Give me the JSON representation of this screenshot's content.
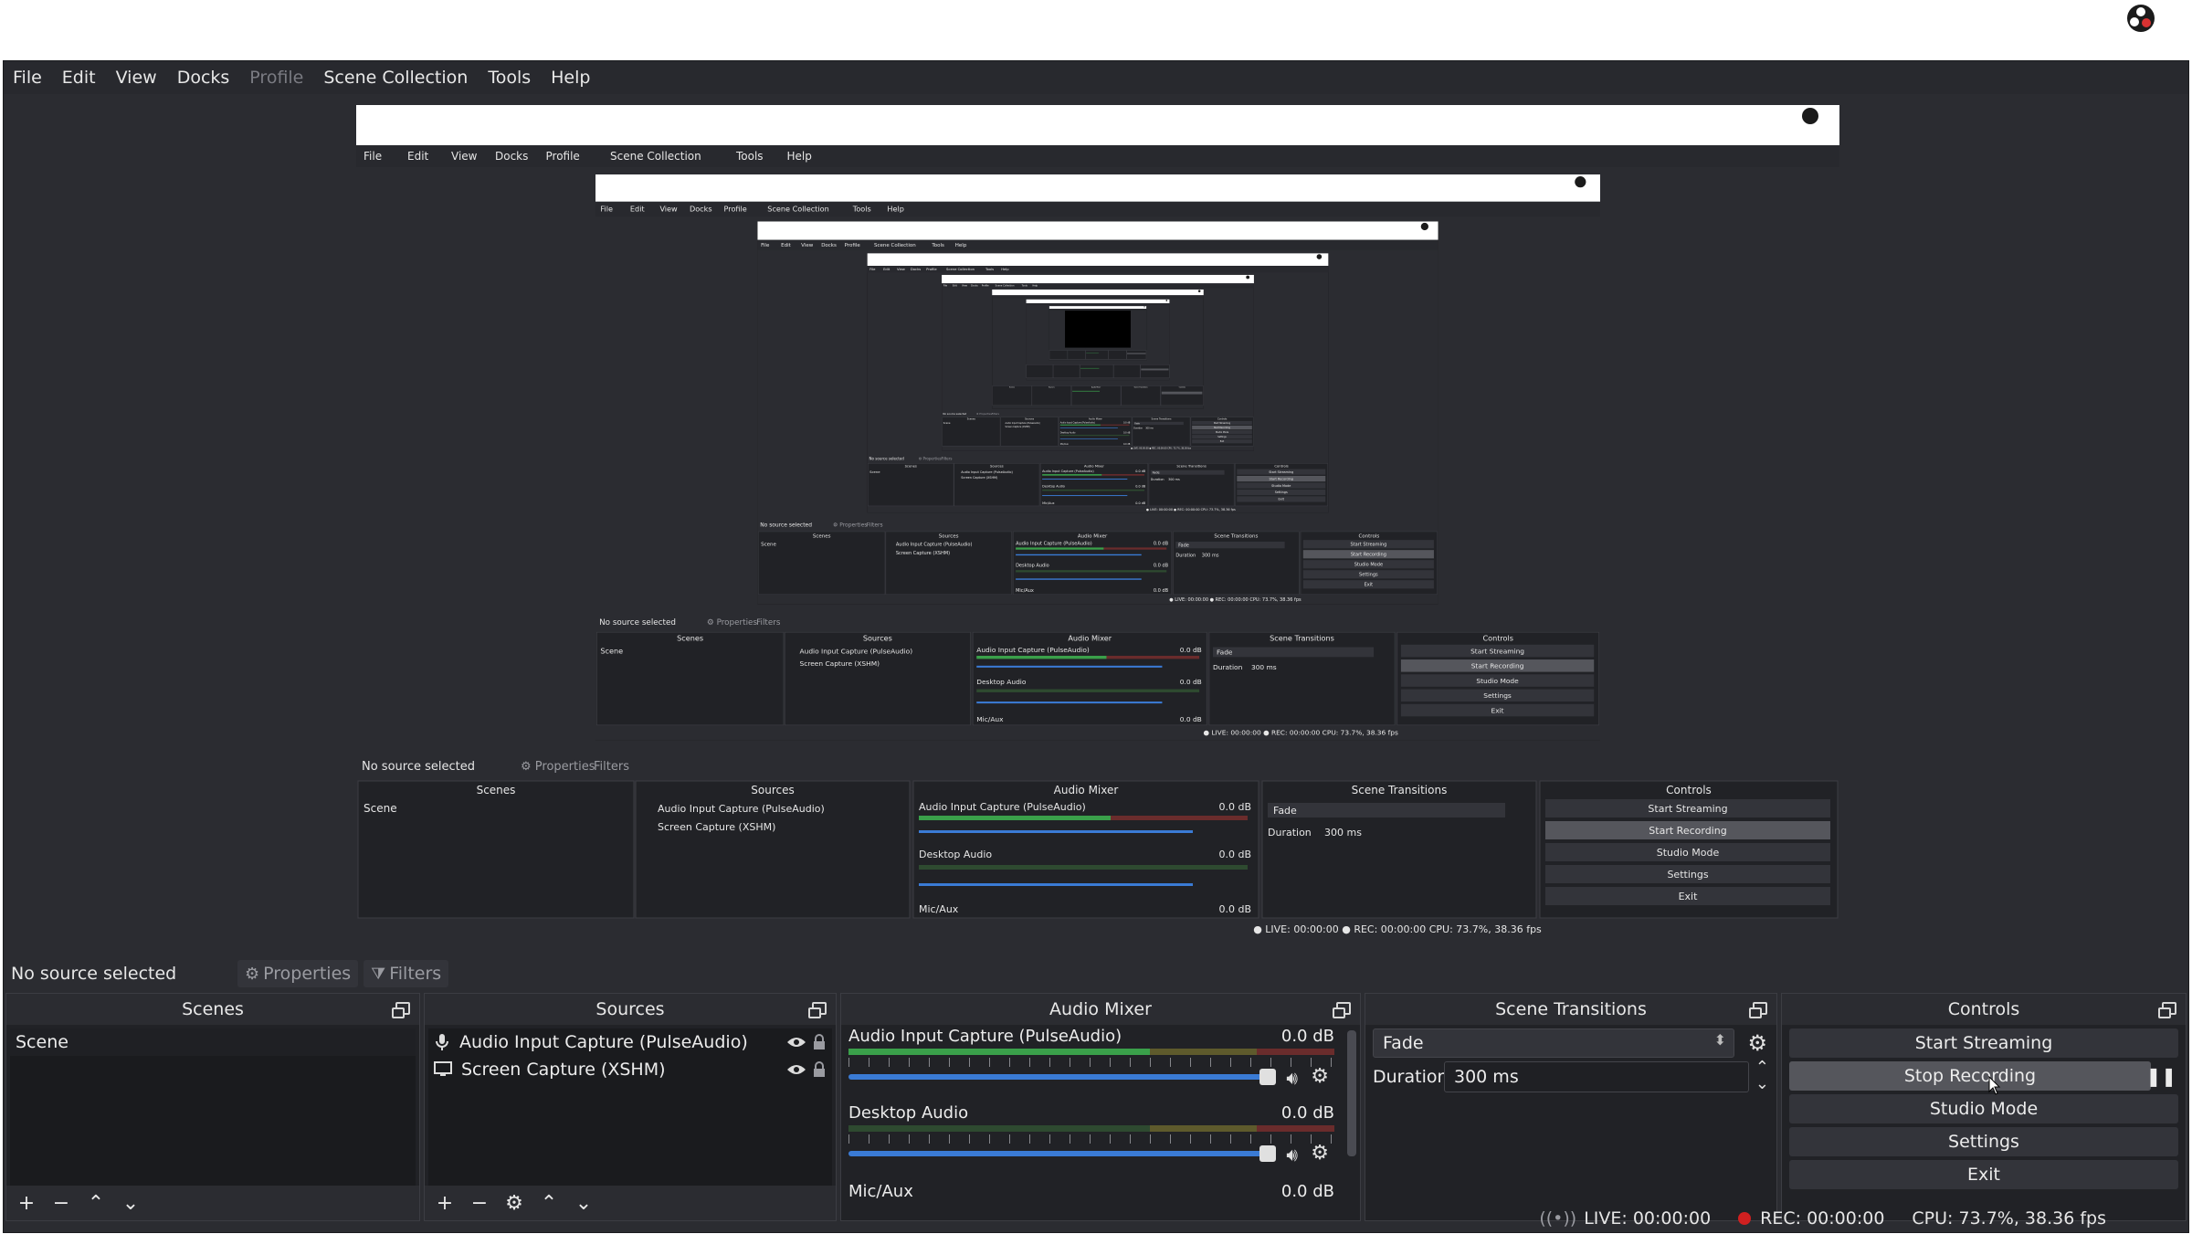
{
  "menu": [
    "File",
    "Edit",
    "View",
    "Docks",
    "Profile",
    "Scene Collection",
    "Tools",
    "Help"
  ],
  "menu_disabled": "Profile",
  "sourcebar": {
    "no_source": "No source selected",
    "properties": "Properties",
    "filters": "Filters"
  },
  "scenes": {
    "title": "Scenes",
    "items": [
      "Scene"
    ]
  },
  "sources": {
    "title": "Sources",
    "items": [
      {
        "label": "Audio Input Capture (PulseAudio)",
        "icon": "microphone-icon"
      },
      {
        "label": "Screen Capture (XSHM)",
        "icon": "monitor-icon"
      }
    ]
  },
  "mixer": {
    "title": "Audio Mixer",
    "channels": [
      {
        "name": "Audio Input Capture (PulseAudio)",
        "db": "0.0 dB",
        "level": 0.75,
        "volume": 1.0
      },
      {
        "name": "Desktop Audio",
        "db": "0.0 dB",
        "level": 0.0,
        "volume": 1.0
      },
      {
        "name": "Mic/Aux",
        "db": "0.0 dB",
        "level": 0.0,
        "volume": 1.0
      }
    ]
  },
  "transitions": {
    "title": "Scene Transitions",
    "selected": "Fade",
    "duration_label": "Duration",
    "duration_value": "300 ms"
  },
  "controls": {
    "title": "Controls",
    "start_streaming": "Start Streaming",
    "stop_recording": "Stop Recording",
    "studio_mode": "Studio Mode",
    "settings": "Settings",
    "exit": "Exit"
  },
  "status": {
    "live": "LIVE: 00:00:00",
    "rec": "REC: 00:00:00",
    "cpu": "CPU: 73.7%, 38.36 fps"
  },
  "nested_preview": {
    "menu": [
      "File",
      "Edit",
      "View",
      "Docks",
      "Profile",
      "Scene Collection",
      "Tools",
      "Help"
    ],
    "no_source": "No source selected",
    "properties": "Properties",
    "filters": "Filters",
    "scenes": "Scenes",
    "sources": "Sources",
    "mixer": "Audio Mixer",
    "transitions": "Scene Transitions",
    "controls": "Controls",
    "scene_item": "Scene",
    "src1": "Audio Input Capture (PulseAudio)",
    "src2": "Screen Capture (XSHM)",
    "mix1": "Audio Input Capture (PulseAudio)",
    "mix2": "Desktop Audio",
    "mix3": "Mic/Aux",
    "db": "0.0 dB",
    "fade": "Fade",
    "duration": "Duration",
    "duration_value": "300 ms",
    "start_streaming": "Start Streaming",
    "start_recording": "Start Recording",
    "studio_mode": "Studio Mode",
    "settings": "Settings",
    "exit": "Exit",
    "live": "LIVE: 00:00:00",
    "rec": "REC: 00:00:00",
    "cpu": "CPU: 73.7%, 38.36 fps"
  },
  "colors": {
    "accent": "#3a7bd5",
    "rec": "#d02020",
    "meter_green": "#3aa04a"
  }
}
